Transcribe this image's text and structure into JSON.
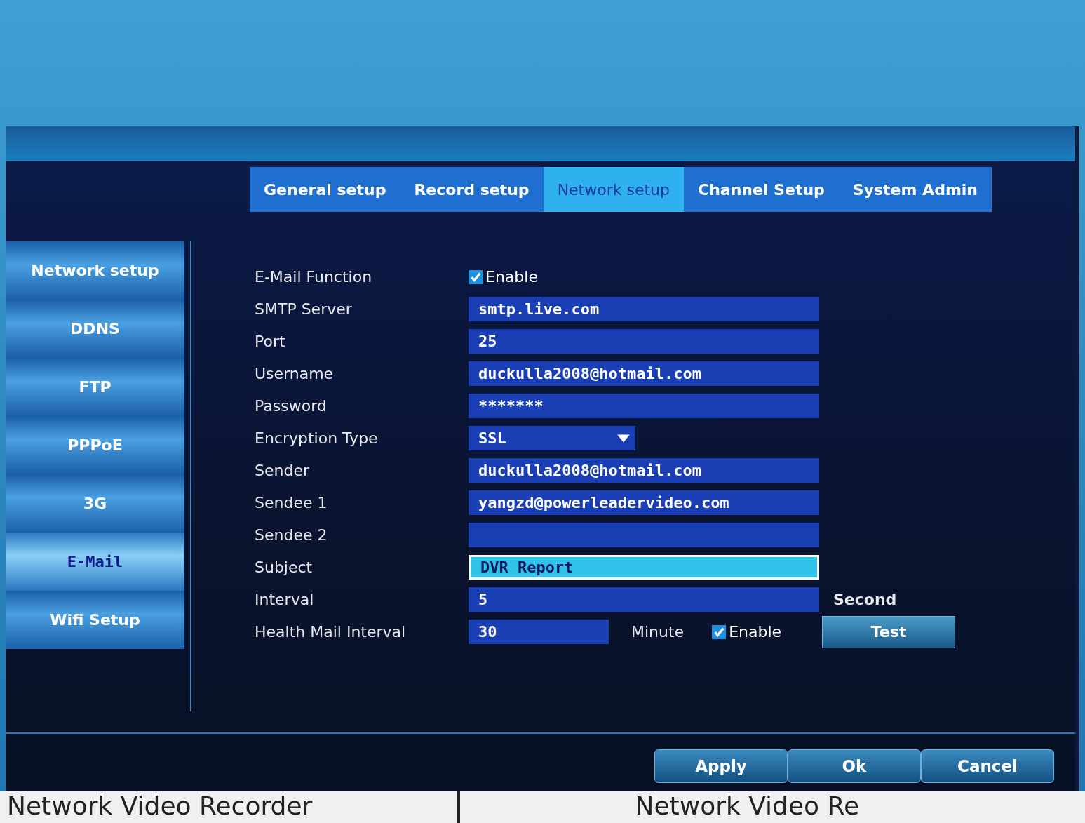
{
  "tabs": [
    {
      "label": "General setup",
      "selected": false
    },
    {
      "label": "Record setup",
      "selected": false
    },
    {
      "label": "Network setup",
      "selected": true
    },
    {
      "label": "Channel Setup",
      "selected": false
    },
    {
      "label": "System Admin",
      "selected": false
    }
  ],
  "sidebar": {
    "items": [
      {
        "label": "Network setup",
        "selected": false
      },
      {
        "label": "DDNS",
        "selected": false
      },
      {
        "label": "FTP",
        "selected": false
      },
      {
        "label": "PPPoE",
        "selected": false
      },
      {
        "label": "3G",
        "selected": false
      },
      {
        "label": "E-Mail",
        "selected": true
      },
      {
        "label": "Wifi Setup",
        "selected": false
      }
    ]
  },
  "fields": [
    {
      "kind": "checkbox",
      "label": "E-Mail Function",
      "option": "Enable",
      "checked": true
    },
    {
      "kind": "text",
      "label": "SMTP Server",
      "value": "smtp.live.com",
      "focused": false
    },
    {
      "kind": "text",
      "label": "Port",
      "value": "25",
      "focused": false
    },
    {
      "kind": "text",
      "label": "Username",
      "value": "duckulla2008@hotmail.com",
      "focused": false
    },
    {
      "kind": "text",
      "label": "Password",
      "value": "*******",
      "focused": false
    },
    {
      "kind": "select",
      "label": "Encryption Type",
      "value": "SSL"
    },
    {
      "kind": "text",
      "label": "Sender",
      "value": "duckulla2008@hotmail.com",
      "focused": false
    },
    {
      "kind": "text",
      "label": "Sendee 1",
      "value": "yangzd@powerleadervideo.com",
      "focused": false
    },
    {
      "kind": "text",
      "label": "Sendee 2",
      "focused": false
    },
    {
      "kind": "text",
      "label": "Subject",
      "value": "DVR Report",
      "focused": true
    },
    {
      "kind": "text",
      "label": "Interval",
      "value": "5",
      "unit": "Second",
      "focused": false
    },
    {
      "kind": "health",
      "label": "Health Mail Interval",
      "value": "30",
      "unit": "Minute",
      "option": "Enable",
      "checked": true,
      "button": "Test"
    }
  ],
  "buttons": [
    "Apply",
    "Ok",
    "Cancel"
  ],
  "footer": {
    "left_caption": "Network Video Recorder",
    "right_caption": "Network Video Re"
  }
}
